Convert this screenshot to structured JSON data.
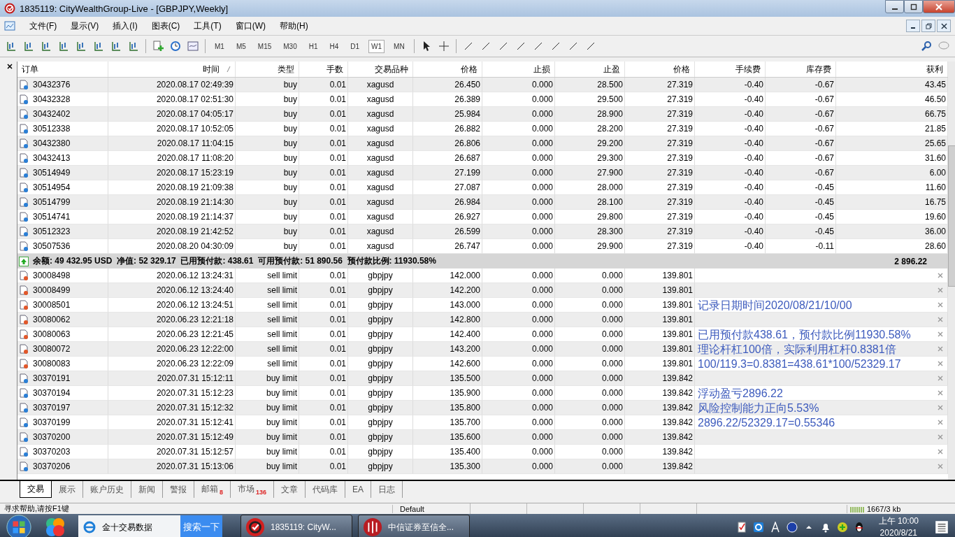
{
  "window": {
    "title": "1835119: CityWealthGroup-Live - [GBPJPY,Weekly]"
  },
  "menu": [
    "文件(F)",
    "显示(V)",
    "插入(I)",
    "图表(C)",
    "工具(T)",
    "窗口(W)",
    "帮助(H)"
  ],
  "timeframes": [
    {
      "label": "M1",
      "selected": false
    },
    {
      "label": "M5",
      "selected": false
    },
    {
      "label": "M15",
      "selected": false
    },
    {
      "label": "M30",
      "selected": false
    },
    {
      "label": "H1",
      "selected": false
    },
    {
      "label": "H4",
      "selected": false
    },
    {
      "label": "D1",
      "selected": false
    },
    {
      "label": "W1",
      "selected": true
    },
    {
      "label": "MN",
      "selected": false
    }
  ],
  "table": {
    "columns": [
      "订单",
      "时间",
      "类型",
      "手数",
      "交易品种",
      "价格",
      "止损",
      "止盈",
      "价格",
      "手续费",
      "库存费",
      "获利"
    ],
    "rows": [
      {
        "kind": "position",
        "color": "#2a7fd6",
        "cells": [
          "30432376",
          "2020.08.17 02:49:39",
          "buy",
          "0.01",
          "xagusd",
          "26.450",
          "0.000",
          "28.500",
          "27.319",
          "-0.40",
          "-0.67",
          "43.45"
        ]
      },
      {
        "kind": "position",
        "color": "#2a7fd6",
        "cells": [
          "30432328",
          "2020.08.17 02:51:30",
          "buy",
          "0.01",
          "xagusd",
          "26.389",
          "0.000",
          "29.500",
          "27.319",
          "-0.40",
          "-0.67",
          "46.50"
        ]
      },
      {
        "kind": "position",
        "color": "#2a7fd6",
        "cells": [
          "30432402",
          "2020.08.17 04:05:17",
          "buy",
          "0.01",
          "xagusd",
          "25.984",
          "0.000",
          "28.900",
          "27.319",
          "-0.40",
          "-0.67",
          "66.75"
        ]
      },
      {
        "kind": "position",
        "color": "#2a7fd6",
        "cells": [
          "30512338",
          "2020.08.17 10:52:05",
          "buy",
          "0.01",
          "xagusd",
          "26.882",
          "0.000",
          "28.200",
          "27.319",
          "-0.40",
          "-0.67",
          "21.85"
        ]
      },
      {
        "kind": "position",
        "color": "#2a7fd6",
        "cells": [
          "30432380",
          "2020.08.17 11:04:15",
          "buy",
          "0.01",
          "xagusd",
          "26.806",
          "0.000",
          "29.200",
          "27.319",
          "-0.40",
          "-0.67",
          "25.65"
        ]
      },
      {
        "kind": "position",
        "color": "#2a7fd6",
        "cells": [
          "30432413",
          "2020.08.17 11:08:20",
          "buy",
          "0.01",
          "xagusd",
          "26.687",
          "0.000",
          "29.300",
          "27.319",
          "-0.40",
          "-0.67",
          "31.60"
        ]
      },
      {
        "kind": "position",
        "color": "#2a7fd6",
        "cells": [
          "30514949",
          "2020.08.17 15:23:19",
          "buy",
          "0.01",
          "xagusd",
          "27.199",
          "0.000",
          "27.900",
          "27.319",
          "-0.40",
          "-0.67",
          "6.00"
        ]
      },
      {
        "kind": "position",
        "color": "#2a7fd6",
        "cells": [
          "30514954",
          "2020.08.19 21:09:38",
          "buy",
          "0.01",
          "xagusd",
          "27.087",
          "0.000",
          "28.000",
          "27.319",
          "-0.40",
          "-0.45",
          "11.60"
        ]
      },
      {
        "kind": "position",
        "color": "#2a7fd6",
        "cells": [
          "30514799",
          "2020.08.19 21:14:30",
          "buy",
          "0.01",
          "xagusd",
          "26.984",
          "0.000",
          "28.100",
          "27.319",
          "-0.40",
          "-0.45",
          "16.75"
        ]
      },
      {
        "kind": "position",
        "color": "#2a7fd6",
        "cells": [
          "30514741",
          "2020.08.19 21:14:37",
          "buy",
          "0.01",
          "xagusd",
          "26.927",
          "0.000",
          "29.800",
          "27.319",
          "-0.40",
          "-0.45",
          "19.60"
        ]
      },
      {
        "kind": "position",
        "color": "#2a7fd6",
        "cells": [
          "30512323",
          "2020.08.19 21:42:52",
          "buy",
          "0.01",
          "xagusd",
          "26.599",
          "0.000",
          "28.300",
          "27.319",
          "-0.40",
          "-0.45",
          "36.00"
        ]
      },
      {
        "kind": "position",
        "color": "#2a7fd6",
        "cells": [
          "30507536",
          "2020.08.20 04:30:09",
          "buy",
          "0.01",
          "xagusd",
          "26.747",
          "0.000",
          "29.900",
          "27.319",
          "-0.40",
          "-0.11",
          "28.60"
        ]
      },
      {
        "kind": "summary",
        "text": "余额: 49 432.95 USD  净值: 52 329.17  已用预付款: 438.61  可用预付款: 51 890.56  预付款比例: 11930.58%",
        "profit": "2 896.22"
      },
      {
        "kind": "order",
        "color": "#e2572a",
        "cells": [
          "30008498",
          "2020.06.12 13:24:31",
          "sell limit",
          "0.01",
          "gbpjpy",
          "142.000",
          "0.000",
          "0.000",
          "139.801"
        ]
      },
      {
        "kind": "order",
        "color": "#e2572a",
        "cells": [
          "30008499",
          "2020.06.12 13:24:40",
          "sell limit",
          "0.01",
          "gbpjpy",
          "142.200",
          "0.000",
          "0.000",
          "139.801"
        ]
      },
      {
        "kind": "order",
        "color": "#e2572a",
        "cells": [
          "30008501",
          "2020.06.12 13:24:51",
          "sell limit",
          "0.01",
          "gbpjpy",
          "143.000",
          "0.000",
          "0.000",
          "139.801"
        ],
        "note": "记录日期时间2020/08/21/10/00"
      },
      {
        "kind": "order",
        "color": "#e2572a",
        "cells": [
          "30080062",
          "2020.06.23 12:21:18",
          "sell limit",
          "0.01",
          "gbpjpy",
          "142.800",
          "0.000",
          "0.000",
          "139.801"
        ]
      },
      {
        "kind": "order",
        "color": "#e2572a",
        "cells": [
          "30080063",
          "2020.06.23 12:21:45",
          "sell limit",
          "0.01",
          "gbpjpy",
          "142.400",
          "0.000",
          "0.000",
          "139.801"
        ],
        "note": "已用预付款438.61，预付款比例11930.58%"
      },
      {
        "kind": "order",
        "color": "#e2572a",
        "cells": [
          "30080072",
          "2020.06.23 12:22:00",
          "sell limit",
          "0.01",
          "gbpjpy",
          "143.200",
          "0.000",
          "0.000",
          "139.801"
        ],
        "note": "理论杆杠100倍，实际利用杠杆0.8381倍"
      },
      {
        "kind": "order",
        "color": "#e2572a",
        "cells": [
          "30080083",
          "2020.06.23 12:22:09",
          "sell limit",
          "0.01",
          "gbpjpy",
          "142.600",
          "0.000",
          "0.000",
          "139.801"
        ],
        "note": "100/119.3=0.8381=438.61*100/52329.17"
      },
      {
        "kind": "order",
        "color": "#2a7fd6",
        "cells": [
          "30370191",
          "2020.07.31 15:12:11",
          "buy limit",
          "0.01",
          "gbpjpy",
          "135.500",
          "0.000",
          "0.000",
          "139.842"
        ]
      },
      {
        "kind": "order",
        "color": "#2a7fd6",
        "cells": [
          "30370194",
          "2020.07.31 15:12:23",
          "buy limit",
          "0.01",
          "gbpjpy",
          "135.900",
          "0.000",
          "0.000",
          "139.842"
        ],
        "note": "浮动盈亏2896.22"
      },
      {
        "kind": "order",
        "color": "#2a7fd6",
        "cells": [
          "30370197",
          "2020.07.31 15:12:32",
          "buy limit",
          "0.01",
          "gbpjpy",
          "135.800",
          "0.000",
          "0.000",
          "139.842"
        ],
        "note": "风险控制能力正向5.53%"
      },
      {
        "kind": "order",
        "color": "#2a7fd6",
        "cells": [
          "30370199",
          "2020.07.31 15:12:41",
          "buy limit",
          "0.01",
          "gbpjpy",
          "135.700",
          "0.000",
          "0.000",
          "139.842"
        ],
        "note": "2896.22/52329.17=0.55346"
      },
      {
        "kind": "order",
        "color": "#2a7fd6",
        "cells": [
          "30370200",
          "2020.07.31 15:12:49",
          "buy limit",
          "0.01",
          "gbpjpy",
          "135.600",
          "0.000",
          "0.000",
          "139.842"
        ]
      },
      {
        "kind": "order",
        "color": "#2a7fd6",
        "cells": [
          "30370203",
          "2020.07.31 15:12:57",
          "buy limit",
          "0.01",
          "gbpjpy",
          "135.400",
          "0.000",
          "0.000",
          "139.842"
        ]
      },
      {
        "kind": "order",
        "color": "#2a7fd6",
        "cells": [
          "30370206",
          "2020.07.31 15:13:06",
          "buy limit",
          "0.01",
          "gbpjpy",
          "135.300",
          "0.000",
          "0.000",
          "139.842"
        ]
      }
    ]
  },
  "tabs": [
    {
      "label": "交易",
      "selected": true
    },
    {
      "label": "展示",
      "selected": false
    },
    {
      "label": "账户历史",
      "selected": false
    },
    {
      "label": "新闻",
      "selected": false
    },
    {
      "label": "警报",
      "selected": false
    },
    {
      "label": "邮箱",
      "badge": "8",
      "selected": false
    },
    {
      "label": "市场",
      "badge": "136",
      "selected": false
    },
    {
      "label": "文章",
      "selected": false
    },
    {
      "label": "代码库",
      "selected": false
    },
    {
      "label": "EA",
      "selected": false
    },
    {
      "label": "日志",
      "selected": false
    }
  ],
  "status_bar": {
    "help": "寻求帮助,请按F1键",
    "profile": "Default",
    "traffic": "1667/3 kb"
  },
  "taskbar": {
    "search_value": "金十交易数据",
    "search_button": "搜索一下",
    "apps": [
      {
        "kind": "mt4",
        "label": "1835119: CityW..."
      },
      {
        "kind": "citic",
        "label": "中信证券至信全..."
      }
    ],
    "time": "上午 10:00",
    "date": "2020/8/21"
  }
}
